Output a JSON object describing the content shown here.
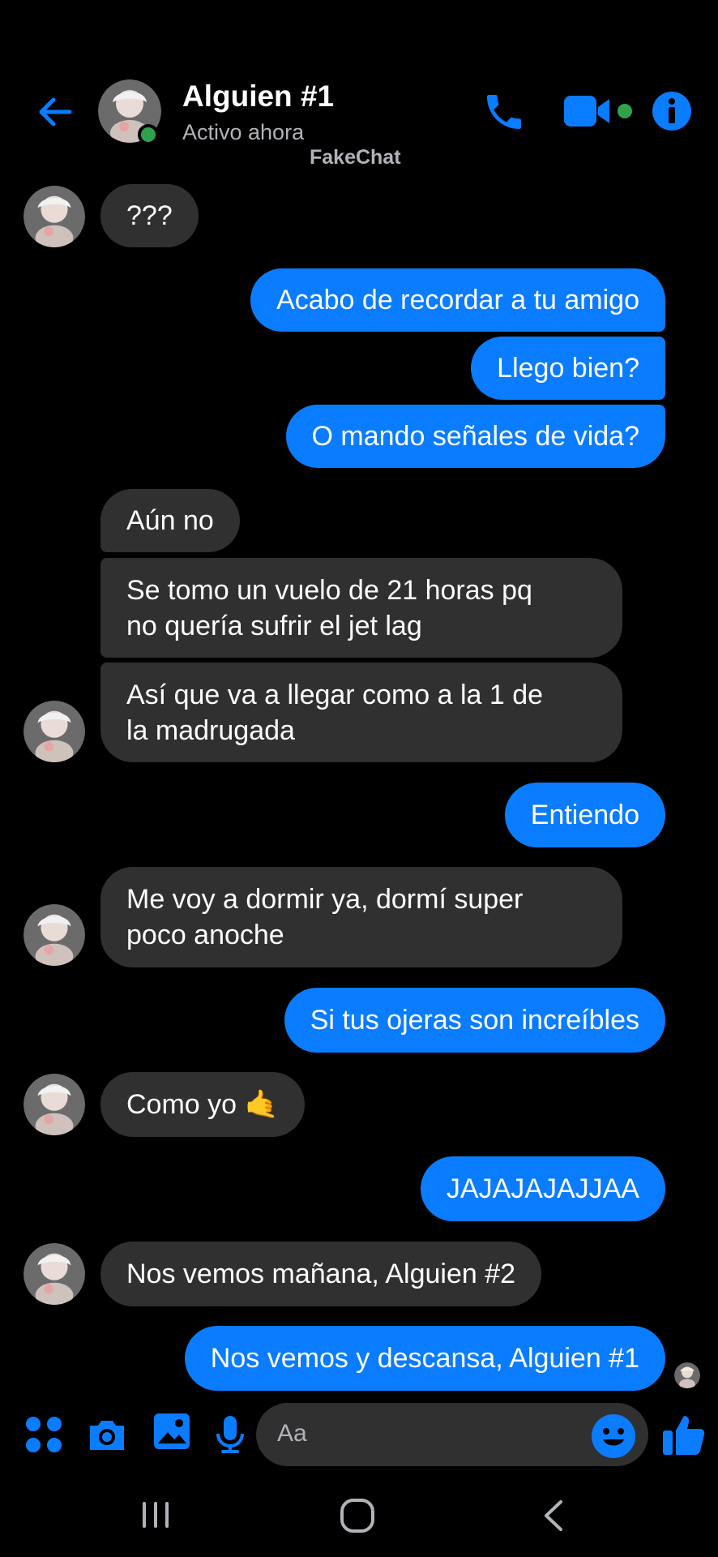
{
  "header": {
    "contact_name": "Alguien #1",
    "status": "Activo ahora",
    "watermark": "FakeChat",
    "icons": [
      "back-arrow-icon",
      "phone-icon",
      "video-camera-icon",
      "info-icon"
    ]
  },
  "colors": {
    "accent": "#0a7cff",
    "incoming_bubble": "#303030",
    "online": "#31a24c",
    "background": "#000000"
  },
  "messages": [
    {
      "from": "them",
      "text": "???"
    },
    {
      "from": "me",
      "text": "Acabo de recordar a tu amigo"
    },
    {
      "from": "me",
      "text": "Llego bien?"
    },
    {
      "from": "me",
      "text": "O mando señales de vida?"
    },
    {
      "from": "them",
      "text": "Aún no"
    },
    {
      "from": "them",
      "text": "Se tomo un vuelo de 21 horas pq\nno quería sufrir el jet lag"
    },
    {
      "from": "them",
      "text": "Así que va a llegar como a la 1 de\nla madrugada"
    },
    {
      "from": "me",
      "text": "Entiendo"
    },
    {
      "from": "them",
      "text": "Me voy a dormir ya, dormí super\npoco anoche"
    },
    {
      "from": "me",
      "text": "Si tus ojeras son increíbles"
    },
    {
      "from": "them",
      "text": "Como yo 🤙"
    },
    {
      "from": "me",
      "text": "JAJAJAJAJJAA"
    },
    {
      "from": "them",
      "text": "Nos vemos mañana, Alguien #2"
    },
    {
      "from": "me",
      "text": "Nos vemos y descansa, Alguien #1"
    }
  ],
  "composer": {
    "placeholder": "Aa",
    "icons": [
      "apps-icon",
      "camera-icon",
      "gallery-icon",
      "microphone-icon",
      "emoji-icon",
      "thumbs-up-icon"
    ]
  },
  "system_nav": [
    "recent-apps-icon",
    "home-icon",
    "back-icon"
  ]
}
